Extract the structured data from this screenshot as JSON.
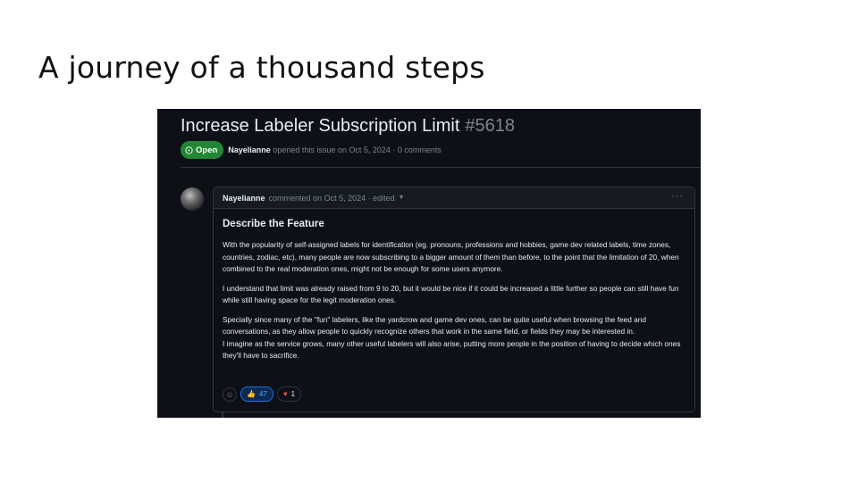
{
  "slide": {
    "title": "A journey of a thousand steps"
  },
  "issue": {
    "title": "Increase Labeler Subscription Limit",
    "number": "#5618",
    "status": "Open",
    "author": "Nayelianne",
    "opened_text": "opened this issue on Oct 5, 2024 · 0 comments"
  },
  "comment": {
    "author": "Nayelianne",
    "meta": "commented on Oct 5, 2024 · edited",
    "heading": "Describe the Feature",
    "paragraphs": [
      "With the popularity of self-assigned labels for identification (eg. pronouns, professions and hobbies, game dev related labels, time zones, countries, zodiac, etc), many people are now subscribing to a bigger amount of them than before, to the point that the limitation of 20, when combined to the real moderation ones, might not be enough for some users anymore.",
      "I understand that limit was already raised from 9 to 20, but it would be nice if it could be increased a little further so people can still have fun while still having space for the legit moderation ones.",
      "Specially since many of the \"fun\" labelers, like the yardcrow and game dev ones, can be quite useful when browsing the feed and conversations, as they allow people to quickly recognize others that work in the same field, or fields they may be interested in.",
      "I imagine as the service grows, many other useful labelers will also arise, putting more people in the position of having to decide which ones they'll have to sacrifice."
    ],
    "reactions": [
      {
        "icon": "thumbs-up-icon",
        "glyph": "👍",
        "count": "47"
      },
      {
        "icon": "heart-icon",
        "glyph": "♥",
        "count": "1"
      }
    ]
  },
  "colors": {
    "open_badge": "#238636",
    "background": "#0d1117",
    "accent_blue": "#58a6ff",
    "heart": "#f85149"
  }
}
